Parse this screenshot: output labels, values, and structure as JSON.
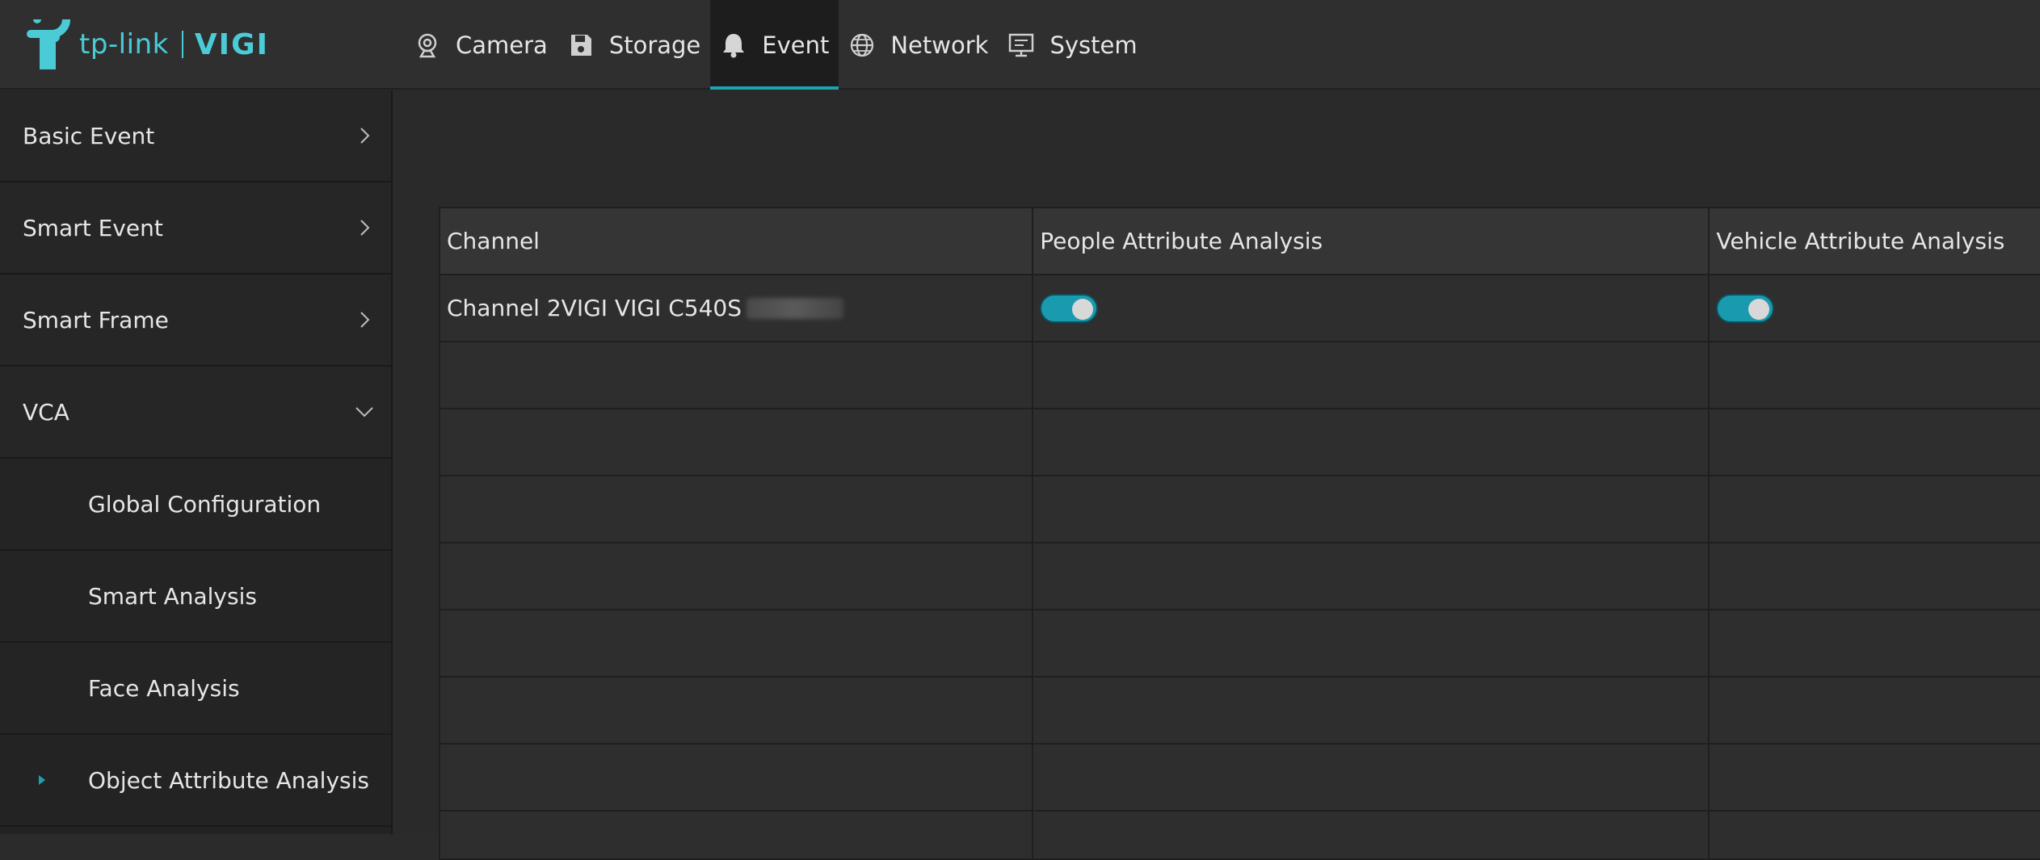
{
  "brand": {
    "name": "tp-link",
    "product": "VIGI",
    "accent_color": "#4acbd6"
  },
  "nav": {
    "items": [
      {
        "label": "Camera",
        "icon": "camera-icon"
      },
      {
        "label": "Storage",
        "icon": "floppy-disk-icon"
      },
      {
        "label": "Event",
        "icon": "bell-icon",
        "active": true
      },
      {
        "label": "Network",
        "icon": "globe-icon"
      },
      {
        "label": "System",
        "icon": "monitor-icon"
      }
    ],
    "active_color": "#1aa3b4"
  },
  "sidebar": {
    "items": [
      {
        "label": "Basic Event",
        "type": "section",
        "state": "collapsed"
      },
      {
        "label": "Smart Event",
        "type": "section",
        "state": "collapsed"
      },
      {
        "label": "Smart Frame",
        "type": "section",
        "state": "collapsed"
      },
      {
        "label": "VCA",
        "type": "section",
        "state": "expanded"
      },
      {
        "label": "Global Configuration",
        "type": "sub"
      },
      {
        "label": "Smart Analysis",
        "type": "sub"
      },
      {
        "label": "Face Analysis",
        "type": "sub"
      },
      {
        "label": "Object Attribute Analysis",
        "type": "sub",
        "selected": true
      }
    ]
  },
  "table": {
    "columns": [
      "Channel",
      "People Attribute Analysis",
      "Vehicle Attribute Analysis"
    ],
    "rows": [
      {
        "channel": "Channel 2VIGI VIGI C540S",
        "people_attribute_analysis": "on",
        "vehicle_attribute_analysis": "on"
      }
    ],
    "toggle_on_color": "#1a9aae"
  }
}
